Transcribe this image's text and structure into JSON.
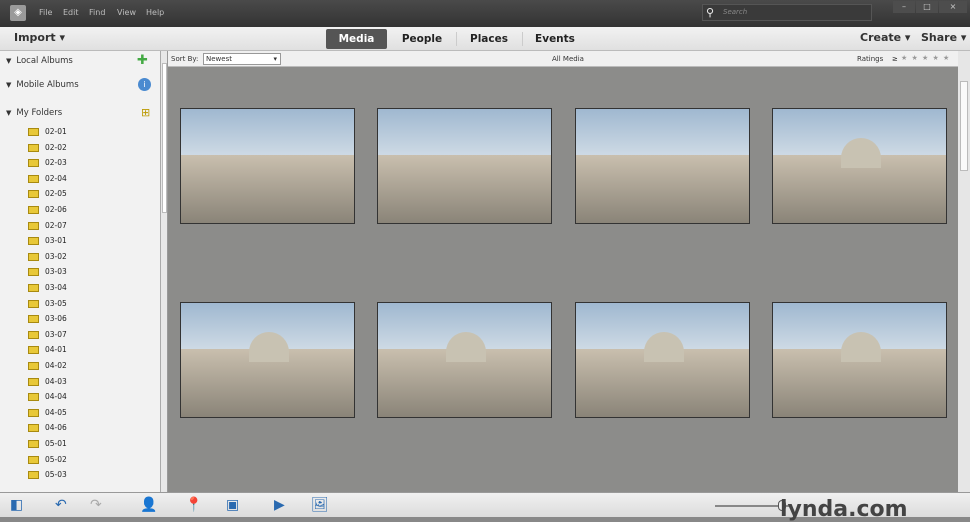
{
  "menu": [
    "File",
    "Edit",
    "Find",
    "View",
    "Help"
  ],
  "search": {
    "placeholder": "Search"
  },
  "window_buttons": [
    "–",
    "□",
    "×"
  ],
  "toolbar": {
    "import": "Import ▾",
    "tabs": [
      "Media",
      "People",
      "Places",
      "Events"
    ],
    "active_tab": "Media",
    "create": "Create ▾",
    "share": "Share ▾"
  },
  "sidebar": {
    "local_albums": "Local Albums",
    "mobile_albums": "Mobile Albums",
    "my_folders": "My Folders",
    "folders": [
      "02-01",
      "02-02",
      "02-03",
      "02-04",
      "02-05",
      "02-06",
      "02-07",
      "03-01",
      "03-02",
      "03-03",
      "03-04",
      "03-05",
      "03-06",
      "03-07",
      "04-01",
      "04-02",
      "04-03",
      "04-04",
      "04-05",
      "04-06",
      "05-01",
      "05-02",
      "05-03"
    ]
  },
  "sortbar": {
    "label": "Sort By:",
    "value": "Newest",
    "title": "All Media",
    "ratings": "Ratings",
    "ge": "≥",
    "stars": "★ ★ ★ ★ ★"
  },
  "bottom": {
    "logo": "lynda.com"
  }
}
